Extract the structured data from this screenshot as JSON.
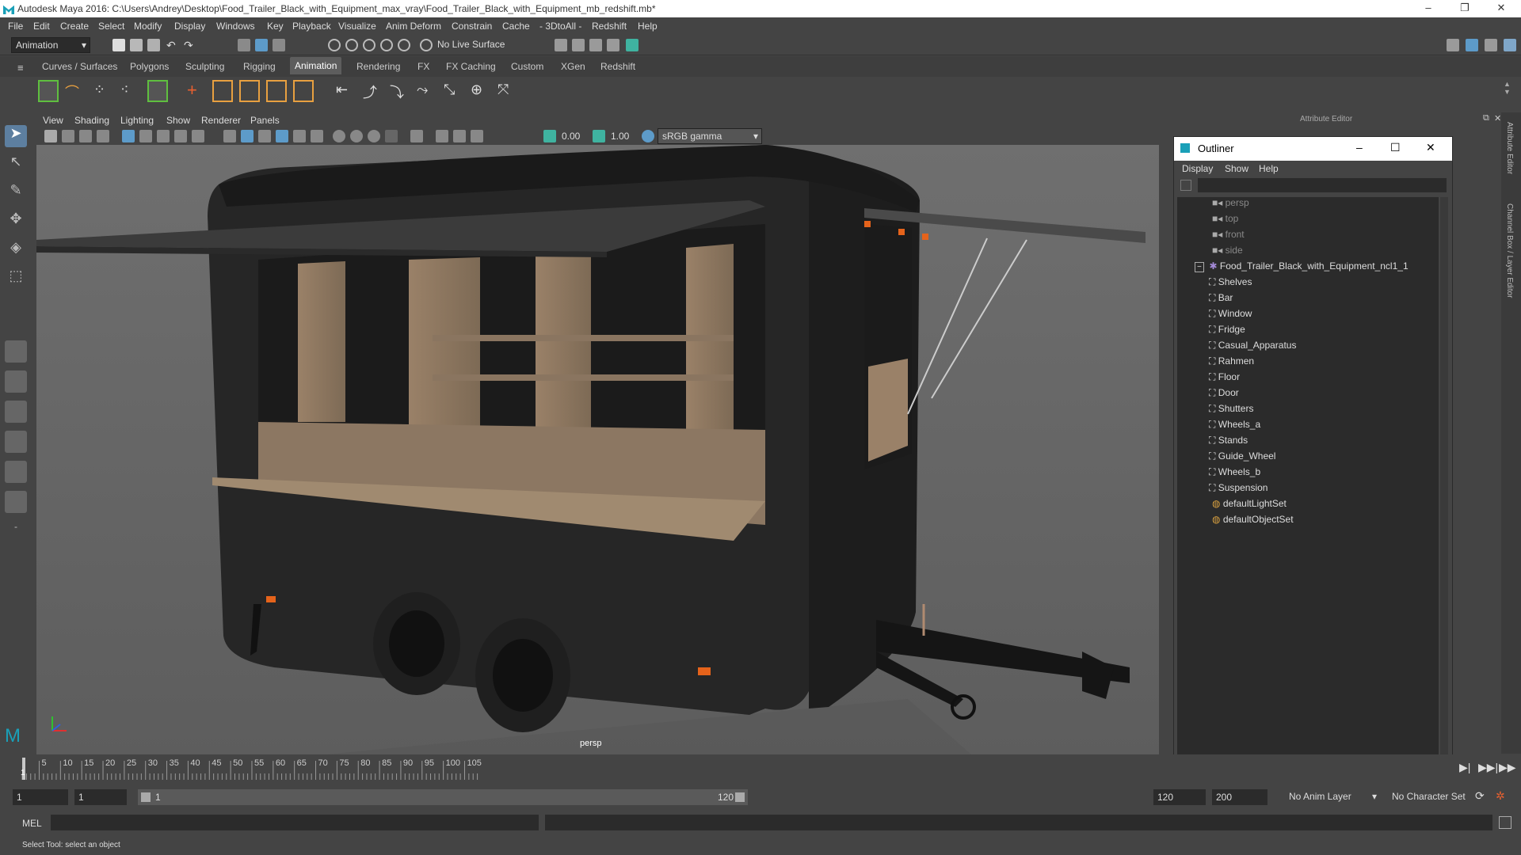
{
  "window": {
    "title": "Autodesk Maya 2016: C:\\Users\\Andrey\\Desktop\\Food_Trailer_Black_with_Equipment_max_vray\\Food_Trailer_Black_with_Equipment_mb_redshift.mb*"
  },
  "menubar": {
    "items": [
      "File",
      "Edit",
      "Create",
      "Select",
      "Modify",
      "Display",
      "Windows",
      "Key",
      "Playback",
      "Visualize",
      "Anim Deform",
      "Constrain",
      "Cache",
      "- 3DtoAll -",
      "Redshift",
      "Help"
    ]
  },
  "statusline": {
    "menuset": "Animation",
    "live_surface": "No Live Surface"
  },
  "shelf": {
    "tabs": [
      "Curves / Surfaces",
      "Polygons",
      "Sculpting",
      "Rigging",
      "Animation",
      "Rendering",
      "FX",
      "FX Caching",
      "Custom",
      "XGen",
      "Redshift"
    ],
    "active_tab": "Animation"
  },
  "panel": {
    "menus": [
      "View",
      "Shading",
      "Lighting",
      "Show",
      "Renderer",
      "Panels"
    ],
    "exposure": "0.00",
    "gamma": "1.00",
    "colorspace": "sRGB gamma",
    "camera_label": "persp"
  },
  "attribute_editor": {
    "title": "Attribute Editor"
  },
  "side_tabs": {
    "attr": "Attribute Editor",
    "channel": "Channel Box / Layer Editor"
  },
  "outliner": {
    "title": "Outliner",
    "menus": [
      "Display",
      "Show",
      "Help"
    ],
    "cameras": [
      "persp",
      "top",
      "front",
      "side"
    ],
    "root": "Food_Trailer_Black_with_Equipment_ncl1_1",
    "children": [
      "Shelves",
      "Bar",
      "Window",
      "Fridge",
      "Casual_Apparatus",
      "Rahmen",
      "Floor",
      "Door",
      "Shutters",
      "Wheels_a",
      "Stands",
      "Guide_Wheel",
      "Wheels_b",
      "Suspension"
    ],
    "sets": [
      "defaultLightSet",
      "defaultObjectSet"
    ]
  },
  "timeline": {
    "ticks": [
      "5",
      "10",
      "15",
      "20",
      "25",
      "30",
      "35",
      "40",
      "45",
      "50",
      "55",
      "60",
      "65",
      "70",
      "75",
      "80",
      "85",
      "90",
      "95",
      "100",
      "105"
    ],
    "current": "1"
  },
  "range": {
    "start": "1",
    "start2": "1",
    "slider_start": "1",
    "slider_end": "120",
    "end": "120",
    "end2": "200",
    "anim_layer": "No Anim Layer",
    "character_set": "No Character Set"
  },
  "cmdline": {
    "label": "MEL"
  },
  "helpline": {
    "text": "Select Tool: select an object"
  },
  "colors": {
    "accent": "#5d9bc9",
    "bg": "#444444",
    "viewport": "#7b7b7b"
  }
}
